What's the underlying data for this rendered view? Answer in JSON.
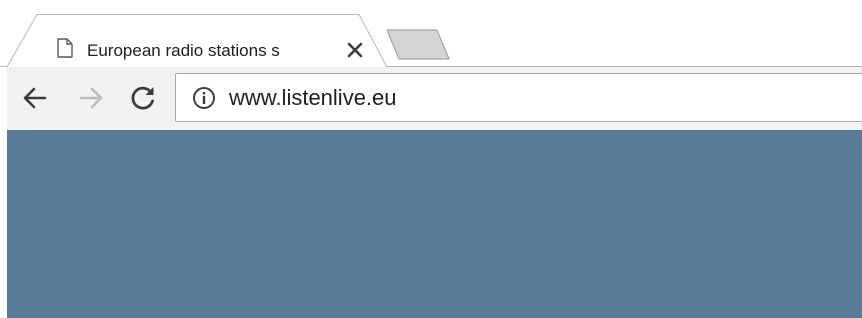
{
  "tab": {
    "title": "European radio stations s",
    "favicon_icon": "page-icon",
    "close_icon": "close-icon"
  },
  "toolbar": {
    "back_icon": "back-arrow-icon",
    "forward_icon": "forward-arrow-icon",
    "reload_icon": "reload-icon",
    "info_icon": "info-icon",
    "url": "www.listenlive.eu"
  },
  "colors": {
    "page_background": "#5a7b96",
    "toolbar_background": "#f2f2f2",
    "new_tab_fill": "#d5d5d5",
    "border": "#b6b6b6"
  }
}
